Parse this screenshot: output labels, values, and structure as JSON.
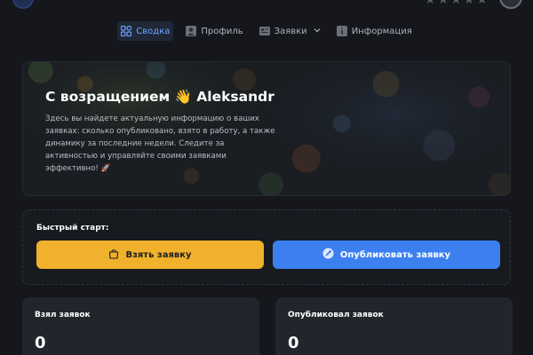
{
  "header": {
    "rating_icon": "star-icon",
    "rating_value": 0,
    "rating_max": 5
  },
  "nav": {
    "items": [
      {
        "label": "Сводка",
        "icon": "dashboard-icon",
        "active": true
      },
      {
        "label": "Профиль",
        "icon": "user-icon",
        "active": false
      },
      {
        "label": "Заявки",
        "icon": "requests-icon",
        "active": false,
        "dropdown": true
      },
      {
        "label": "Информация",
        "icon": "info-icon",
        "active": false
      }
    ]
  },
  "welcome": {
    "title": "С возращением 👋 Aleksandr",
    "text": "Здесь вы найдете актуальную информацию о ваших заявках: сколько опубликовано, взято в работу, а также динамику за последние недели. Следите за активностью и управляйте своими заявками эффективно! 🚀"
  },
  "quick_start": {
    "label": "Быстрый старт:",
    "take_button": "Взять заявку",
    "publish_button": "Опубликовать заявку"
  },
  "stats": [
    {
      "label": "Взял заявок",
      "value": "0"
    },
    {
      "label": "Опубликовал заявок",
      "value": "0"
    }
  ],
  "colors": {
    "accent": "#3c80f0",
    "take_button": "#f0b12c",
    "background": "#15171c"
  }
}
